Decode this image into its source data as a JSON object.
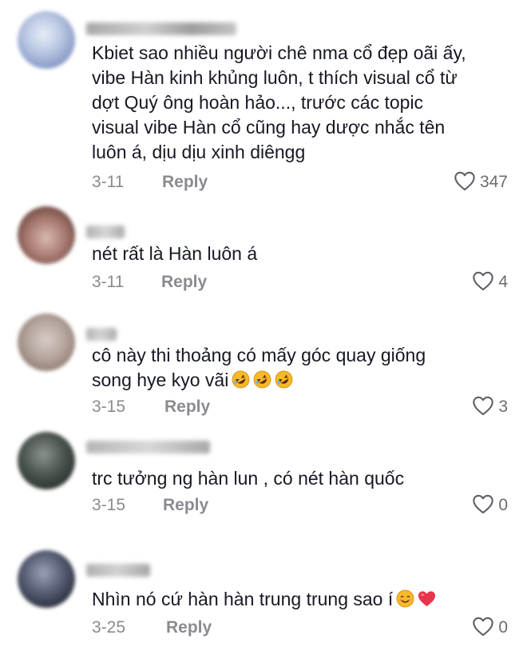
{
  "comments": [
    {
      "text": "Kbiet sao nhiều người chê nma cổ đẹp oãi ấy,\nvibe Hàn kinh khủng luôn, t thích visual cổ từ\ndợt Quý ông hoàn hảo..., trước các topic\nvisual vibe Hàn cổ cũng hay dược nhắc tên\nluôn á, dịu dịu xinh diêngg",
      "date": "3-11",
      "reply": "Reply",
      "likes": "347"
    },
    {
      "text": "nét rất là Hàn luôn á",
      "date": "3-11",
      "reply": "Reply",
      "likes": "4"
    },
    {
      "text": "cô này thi thoảng có mấy góc quay giống\nsong hye kyo vãi",
      "date": "3-15",
      "reply": "Reply",
      "likes": "3"
    },
    {
      "text": "trc tưởng ng hàn lun , có nét hàn quốc",
      "date": "3-15",
      "reply": "Reply",
      "likes": "0"
    },
    {
      "text": "Nhìn nó cứ hàn hàn trung trung sao í",
      "date": "3-25",
      "reply": "Reply",
      "likes": "0"
    }
  ],
  "icons": {
    "like": "heart-outline-icon",
    "laugh": "rolling-on-floor-laughing-emoji",
    "smile": "smiling-face-emoji",
    "heart": "red-heart-emoji"
  },
  "colors": {
    "text": "#161823",
    "meta": "#8a8b91",
    "heart_emoji": "#e8344c",
    "emoji_face": "#f7b928"
  }
}
